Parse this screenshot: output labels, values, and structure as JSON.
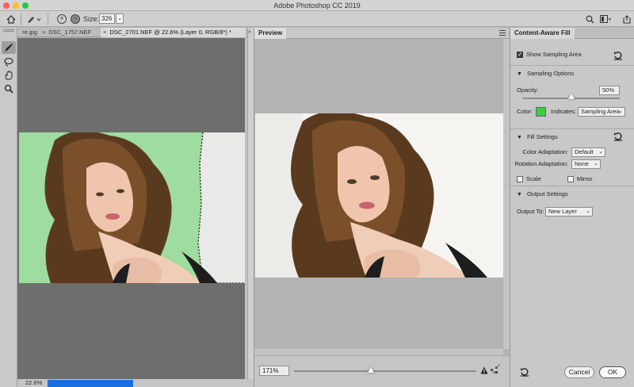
{
  "app": {
    "title": "Adobe Photoshop CC 2019"
  },
  "options_bar": {
    "size_label": "Size:",
    "size_value": "326"
  },
  "doc_tabs": {
    "tabs": [
      {
        "label": "re.jpg",
        "active": false
      },
      {
        "label": "DSC_1757.NEF",
        "active": false
      },
      {
        "label": "DSC_2701.NEF @ 22.6% (Layer 0, RGB/8*) *",
        "active": true
      }
    ]
  },
  "status": {
    "zoom": "22.6%"
  },
  "preview": {
    "tab_label": "Preview",
    "zoom_value": "171%",
    "zoom_slider_level": 0.42
  },
  "content_aware": {
    "tab_label": "Content-Aware Fill",
    "show_sampling_area": {
      "label": "Show Sampling Area",
      "checked": true
    },
    "sampling_options": {
      "title": "Sampling Options",
      "opacity_label": "Opacity:",
      "opacity_value": "50%",
      "opacity_level": 0.5,
      "color_label": "Color:",
      "color_value": "#3fcc3f",
      "indicates_label": "Indicates:",
      "indicates_value": "Sampling Area"
    },
    "fill_settings": {
      "title": "Fill Settings",
      "color_adaptation_label": "Color Adaptation:",
      "color_adaptation_value": "Default",
      "rotation_adaptation_label": "Rotation Adaptation:",
      "rotation_adaptation_value": "None",
      "scale_label": "Scale",
      "scale_checked": false,
      "mirror_label": "Mirror",
      "mirror_checked": false
    },
    "output_settings": {
      "title": "Output Settings",
      "output_to_label": "Output To:",
      "output_to_value": "New Layer"
    },
    "buttons": {
      "cancel": "Cancel",
      "ok": "OK"
    }
  }
}
